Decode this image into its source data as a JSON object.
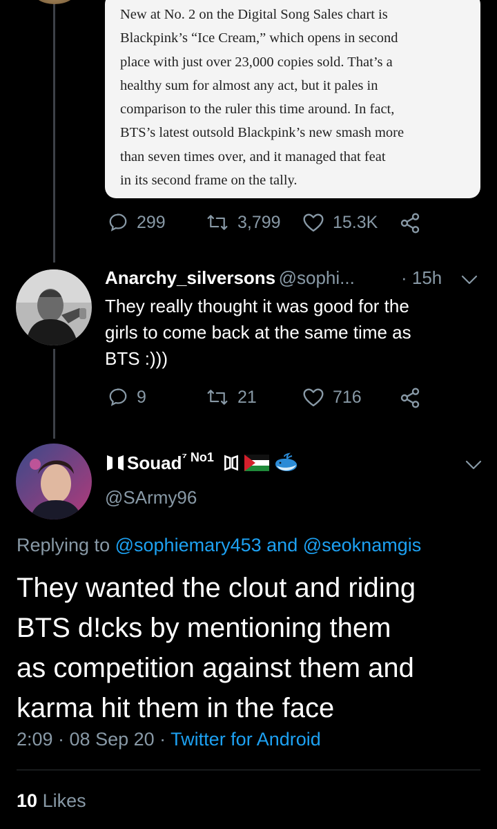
{
  "quote": {
    "lines": [
      "New at No. 2 on the Digital Song Sales chart is",
      "Blackpink’s “Ice Cream,” which opens in second",
      "place with just over 23,000 copies sold. That’s a",
      "healthy sum for almost any act, but it pales in",
      "comparison to the ruler this time around. In fact,",
      "BTS’s latest outsold Blackpink’s new smash more",
      "than seven times over, and it managed that feat",
      "in its second frame on the tally."
    ]
  },
  "tweet1_actions": {
    "replies": "299",
    "retweets": "3,799",
    "likes": "15.3K"
  },
  "reply1": {
    "name": "Anarchy_silversons",
    "handle": "@sophi...",
    "time": "· 15h",
    "text_lines": [
      "They really thought it was good for the",
      "girls to come back at the same time as",
      "BTS :)))"
    ],
    "replies": "9",
    "retweets": "21",
    "likes": "716"
  },
  "main": {
    "name": "Souad",
    "name_suffix": "⁷ No1",
    "handle": "@SArmy96",
    "replying_prefix": "Replying to",
    "replying_user1": "@sophiemary453",
    "replying_and": "and",
    "replying_user2": "@seoknamgis",
    "text_lines": [
      "They wanted the clout and riding",
      "BTS d!cks by mentioning them",
      "as competition against them and",
      "karma hit them in the face"
    ],
    "time": "2:09 · 08 Sep 20 ·",
    "source": "Twitter for Android",
    "likes_count": "10",
    "likes_label": "Likes"
  },
  "colors": {
    "background": "#000000",
    "muted": "#8899a6",
    "link": "#1da1f2",
    "card": "#f4f4f4"
  },
  "icons": [
    "reply-icon",
    "retweet-icon",
    "like-icon",
    "share-icon",
    "chevron-down-icon",
    "flag-icon",
    "whale-icon"
  ]
}
